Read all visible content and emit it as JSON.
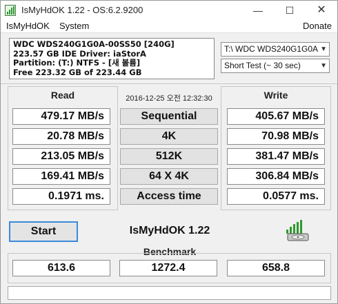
{
  "window": {
    "title": "IsMyHdOK 1.22 - OS:6.2.9200"
  },
  "menu": {
    "items": [
      "IsMyHdOK",
      "System"
    ],
    "donate": "Donate"
  },
  "drive_info": {
    "model": "WDC WDS240G1G0A-00SS50 [240G]",
    "size_driver": "223.57 GB  IDE Driver: iaStorA",
    "partition": "Partition: (T:) NTFS - [새 볼륨]",
    "free": "Free 223.32 GB of 223.44 GB"
  },
  "controls": {
    "drive_select": "T:\\ WDC WDS240G1G0A",
    "test_select": "Short Test (~ 30 sec)"
  },
  "results": {
    "read_header": "Read",
    "write_header": "Write",
    "timestamp": "2016-12-25 오전 12:32:30",
    "rows": [
      {
        "label": "Sequential",
        "read": "479.17 MB/s",
        "write": "405.67 MB/s"
      },
      {
        "label": "4K",
        "read": "20.78 MB/s",
        "write": "70.98 MB/s"
      },
      {
        "label": "512K",
        "read": "213.05 MB/s",
        "write": "381.47 MB/s"
      },
      {
        "label": "64 X 4K",
        "read": "169.41 MB/s",
        "write": "306.84 MB/s"
      },
      {
        "label": "Access time",
        "read": "0.1971 ms.",
        "write": "0.0577 ms."
      }
    ]
  },
  "actions": {
    "start_label": "Start",
    "app_name": "IsMyHdOK 1.22"
  },
  "benchmark": {
    "header": "Benchmark",
    "read": "613.6",
    "total": "1272.4",
    "write": "658.8"
  },
  "status": {
    "text": ""
  },
  "icons": {
    "app": "hdd-signal-icon",
    "brand": "hdd-signal-icon",
    "accent": "#3a8ad8",
    "signal_green": "#2e9a2e"
  }
}
